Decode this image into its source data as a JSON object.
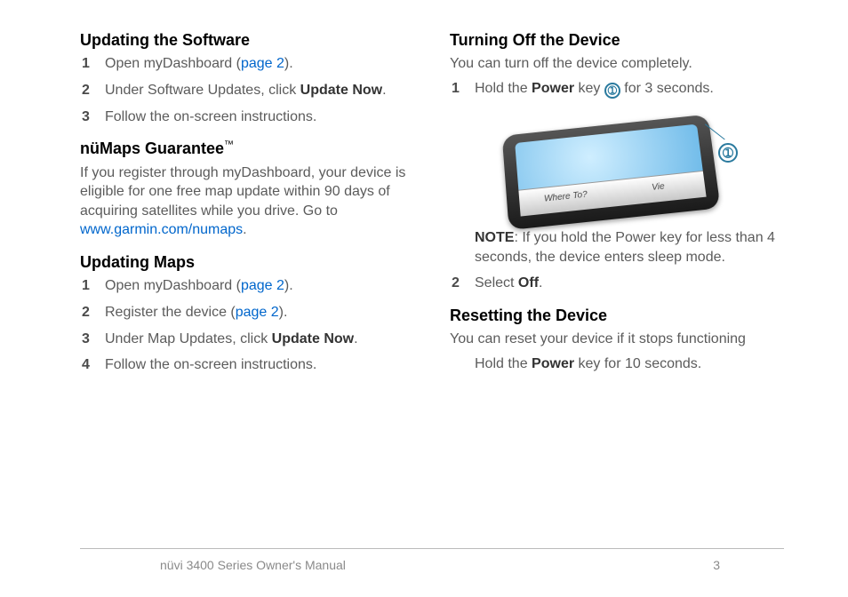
{
  "left": {
    "sec1": {
      "heading": "Updating the Software",
      "steps": [
        {
          "pre": "Open myDashboard (",
          "link": "page 2",
          "post": ")."
        },
        {
          "pre": "Under Software Updates, click ",
          "bold": "Update Now",
          "post": "."
        },
        {
          "pre": "Follow the on-screen instructions."
        }
      ]
    },
    "sec2": {
      "heading": "nüMaps Guarantee",
      "tm": "™",
      "body_pre": "If you register through myDashboard, your device is eligible for one free map update within 90 days of acquiring satellites while you drive. Go to ",
      "body_link": "www.garmin.com/numaps",
      "body_post": "."
    },
    "sec3": {
      "heading": "Updating Maps",
      "steps": [
        {
          "pre": "Open myDashboard (",
          "link": "page 2",
          "post": ")."
        },
        {
          "pre": "Register the device (",
          "link": "page 2",
          "post": ")."
        },
        {
          "pre": "Under Map Updates, click ",
          "bold": "Update Now",
          "post": "."
        },
        {
          "pre": "Follow the on-screen instructions."
        }
      ]
    }
  },
  "right": {
    "sec1": {
      "heading": "Turning Off the Device",
      "intro": "You can turn off the device completely.",
      "step1_pre": "Hold the ",
      "step1_bold": "Power",
      "step1_mid": " key ",
      "step1_callout": "➀",
      "step1_post": " for 3 seconds.",
      "device_btn1": "Where To?",
      "device_btn2": "Vie",
      "note_label": "NOTE",
      "note_body": ": If you hold the Power key for less than 4 seconds, the device enters sleep mode.",
      "step2_pre": "Select ",
      "step2_bold": "Off",
      "step2_post": "."
    },
    "sec2": {
      "heading": "Resetting the Device",
      "intro": "You can reset your device if it stops functioning",
      "line_pre": "Hold the ",
      "line_bold": "Power",
      "line_post": " key for 10 seconds."
    }
  },
  "footer": {
    "left": "nüvi 3400 Series Owner's Manual",
    "right": "3"
  },
  "callout_glyph": "➀"
}
